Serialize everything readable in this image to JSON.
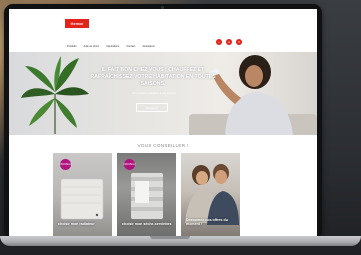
{
  "site": {
    "logo_text": "thermor",
    "brand_color": "#e2231a",
    "accent_color": "#b0147e"
  },
  "nav": {
    "items": [
      {
        "label": "Produits"
      },
      {
        "label": "Aide au choix"
      },
      {
        "label": "Inspirations"
      },
      {
        "label": "Contact"
      },
      {
        "label": "Assistance"
      }
    ]
  },
  "header_icons": [
    {
      "icon": "search-icon",
      "glyph": "⌕"
    },
    {
      "icon": "user-icon",
      "glyph": "●"
    },
    {
      "icon": "menu-icon",
      "glyph": "≡"
    }
  ],
  "hero": {
    "title": "IL FAIT BON CHEZ VOUS ! CHAUFFEZ ET RAFRAÎCHISSEZ VOTRE HABITATION EN TOUTES SAISONS.",
    "subtitle": "Nos solutions adaptées à vos besoins",
    "cta_label": "Découvrir"
  },
  "conseils": {
    "title": "VOUS CONSEILLER !",
    "cards": [
      {
        "label": "choisir mon radiateur",
        "badge": "NOUVEAU"
      },
      {
        "label": "choisir mon sèche-serviettes",
        "badge": "NOUVEAU"
      },
      {
        "label": "Découvrez nos offres du moment !",
        "badge": ""
      }
    ]
  }
}
